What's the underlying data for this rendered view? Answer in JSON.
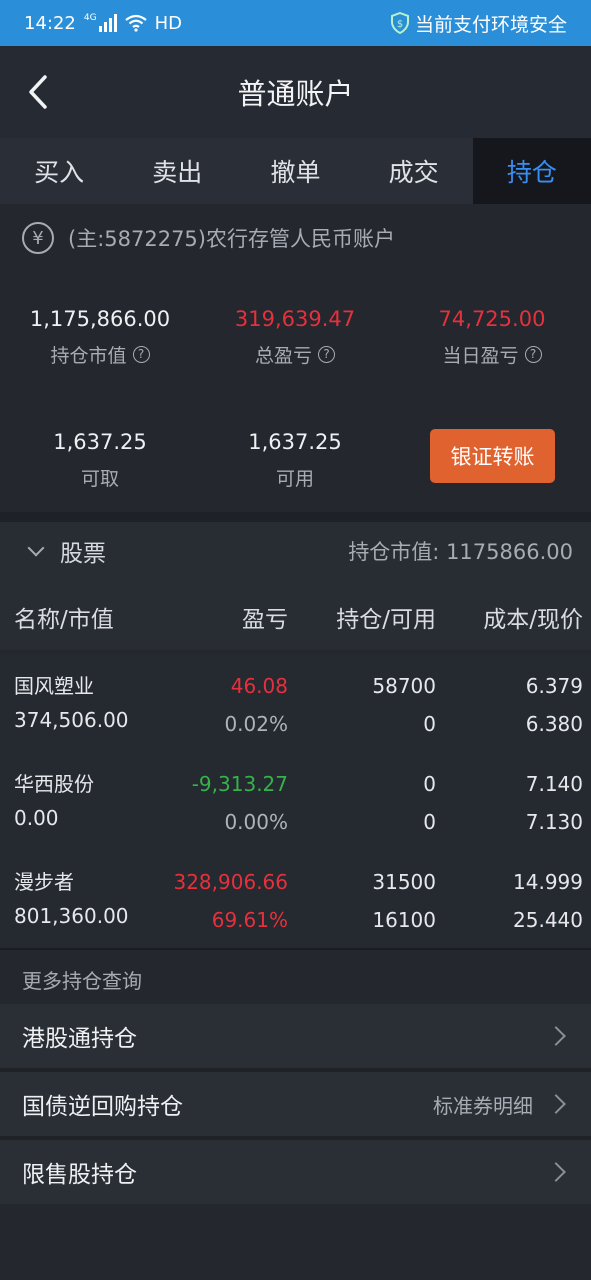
{
  "status_bar": {
    "time": "14:22",
    "network": "4G",
    "hd": "HD",
    "security_text": "当前支付环境安全"
  },
  "nav": {
    "title": "普通账户"
  },
  "tabs": [
    {
      "label": "买入",
      "active": false
    },
    {
      "label": "卖出",
      "active": false
    },
    {
      "label": "撤单",
      "active": false
    },
    {
      "label": "成交",
      "active": false
    },
    {
      "label": "持仓",
      "active": true
    }
  ],
  "account": {
    "currency_symbol": "¥",
    "text": "(主:5872275)农行存管人民币账户"
  },
  "summary": {
    "market_value": {
      "value": "1,175,866.00",
      "label": "持仓市值"
    },
    "total_pnl": {
      "value": "319,639.47",
      "label": "总盈亏"
    },
    "daily_pnl": {
      "value": "74,725.00",
      "label": "当日盈亏"
    },
    "withdrawable": {
      "value": "1,637.25",
      "label": "可取"
    },
    "available": {
      "value": "1,637.25",
      "label": "可用"
    },
    "transfer_button": "银证转账"
  },
  "stocks_section": {
    "title": "股票",
    "market_value_text": "持仓市值: 1175866.00"
  },
  "columns": {
    "name": "名称/市值",
    "pnl": "盈亏",
    "position": "持仓/可用",
    "cost": "成本/现价"
  },
  "holdings": [
    {
      "name": "国风塑业",
      "market_value": "374,506.00",
      "pnl": "46.08",
      "pnl_pct": "0.02%",
      "position": "58700",
      "available": "0",
      "cost": "6.379",
      "price": "6.380",
      "pnl_color": "red"
    },
    {
      "name": "华西股份",
      "market_value": "0.00",
      "pnl": "-9,313.27",
      "pnl_pct": "0.00%",
      "position": "0",
      "available": "0",
      "cost": "7.140",
      "price": "7.130",
      "pnl_color": "green"
    },
    {
      "name": "漫步者",
      "market_value": "801,360.00",
      "pnl": "328,906.66",
      "pnl_pct": "69.61%",
      "position": "31500",
      "available": "16100",
      "cost": "14.999",
      "price": "25.440",
      "pnl_color": "red"
    }
  ],
  "more": {
    "label": "更多持仓查询",
    "links": [
      {
        "label": "港股通持仓",
        "extra": ""
      },
      {
        "label": "国债逆回购持仓",
        "extra": "标准券明细"
      },
      {
        "label": "限售股持仓",
        "extra": ""
      }
    ]
  },
  "colors": {
    "accent": "#3a8ef0",
    "red": "#e5313d",
    "green": "#35b34a",
    "button": "#e0622f",
    "status_bar": "#2a8fd8"
  }
}
